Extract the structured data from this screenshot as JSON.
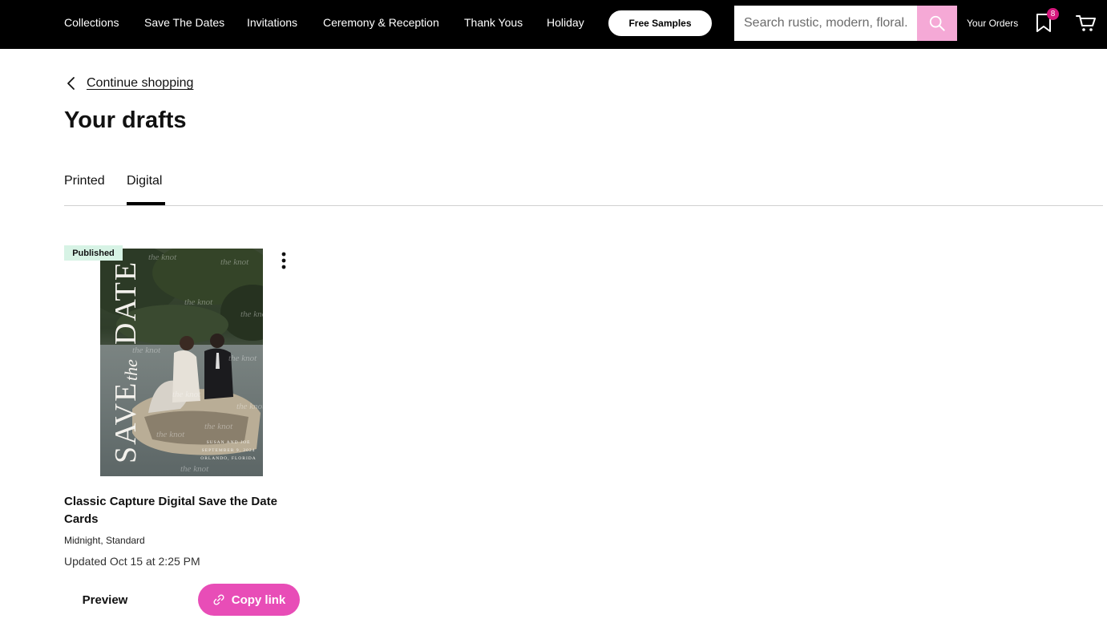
{
  "nav": {
    "links": [
      "Collections",
      "Save The Dates",
      "Invitations",
      "Ceremony & Reception",
      "Thank Yous",
      "Holiday"
    ],
    "free_samples": "Free Samples",
    "search_placeholder": "Search rustic, modern, floral...",
    "orders": "Your Orders",
    "favorites_count": "8",
    "icons": {
      "search": "search-icon",
      "favorites": "bookmark-icon",
      "cart": "cart-icon"
    },
    "accent_color": "#f5a9d6"
  },
  "breadcrumb": {
    "label": "Continue shopping",
    "icon": "chevron-left-icon"
  },
  "page": {
    "title": "Your drafts"
  },
  "tabs": [
    {
      "label": "Printed",
      "selected": false
    },
    {
      "label": "Digital",
      "selected": true
    }
  ],
  "draft": {
    "status": "Published",
    "status_color": "#d7f3e5",
    "title": "Classic Capture Digital Save the Date Cards",
    "variant": "Midnight, Standard",
    "updated": "Updated Oct 15 at 2:25 PM",
    "preview_label": "Preview",
    "copy_label": "Copy link",
    "copy_color": "#e84db7",
    "thumb": {
      "headline": "SAVE the DATE",
      "names": "SUSAN AND JOE",
      "date": "SEPTEMBER 9, 2024",
      "place": "ORLANDO, FLORIDA",
      "watermark": "the knot"
    }
  }
}
